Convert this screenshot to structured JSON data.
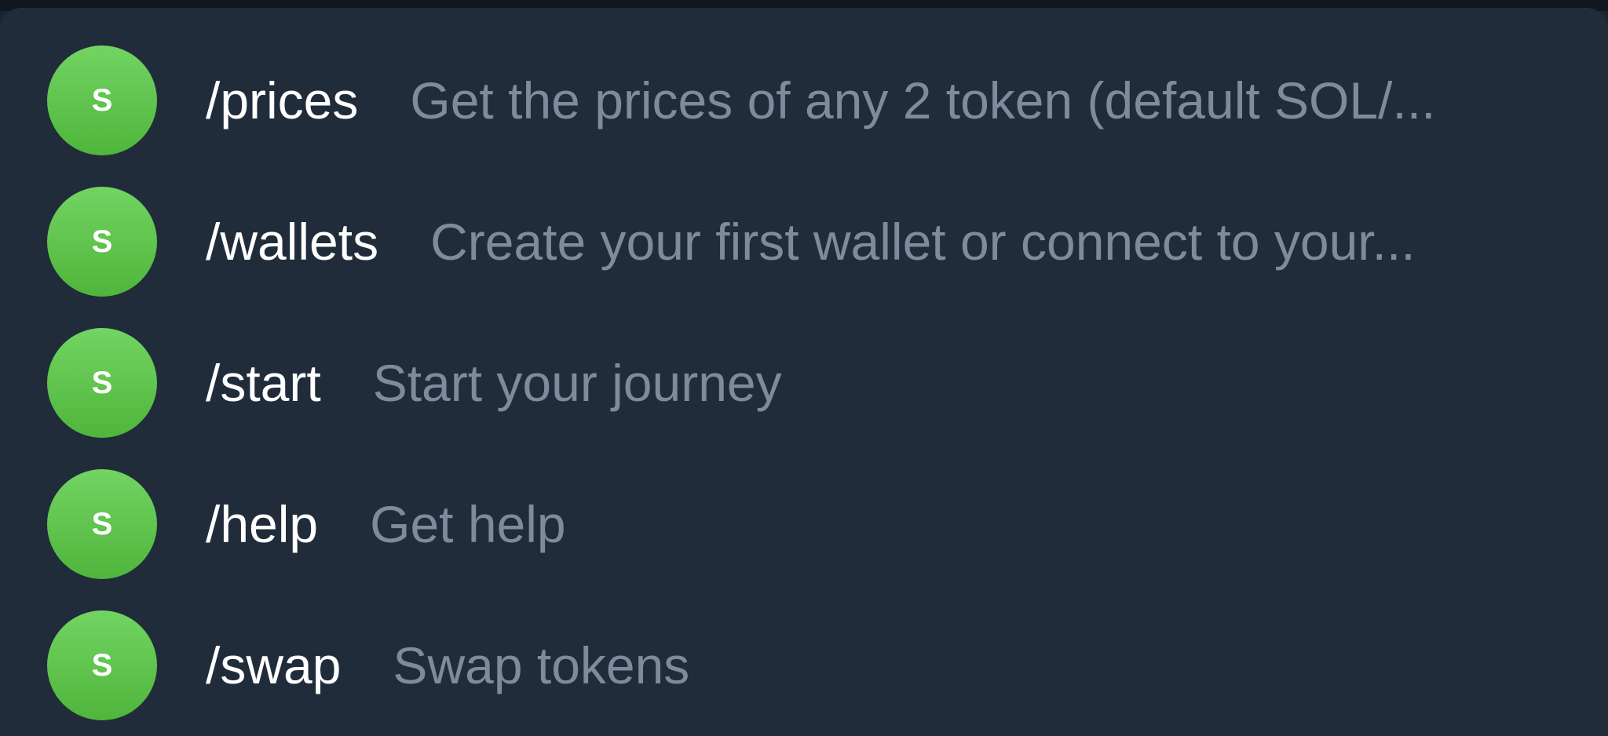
{
  "commands": [
    {
      "avatar_letter": "S",
      "name": "/prices",
      "description": "Get the prices of any 2 token (default SOL/..."
    },
    {
      "avatar_letter": "S",
      "name": "/wallets",
      "description": "Create your first wallet or connect to your..."
    },
    {
      "avatar_letter": "S",
      "name": "/start",
      "description": "Start your journey"
    },
    {
      "avatar_letter": "S",
      "name": "/help",
      "description": "Get help"
    },
    {
      "avatar_letter": "S",
      "name": "/swap",
      "description": "Swap tokens"
    }
  ],
  "colors": {
    "panel_bg": "#212c3b",
    "avatar_green": "#5cc24a",
    "command_text": "#ffffff",
    "description_text": "#7d8b9b"
  }
}
